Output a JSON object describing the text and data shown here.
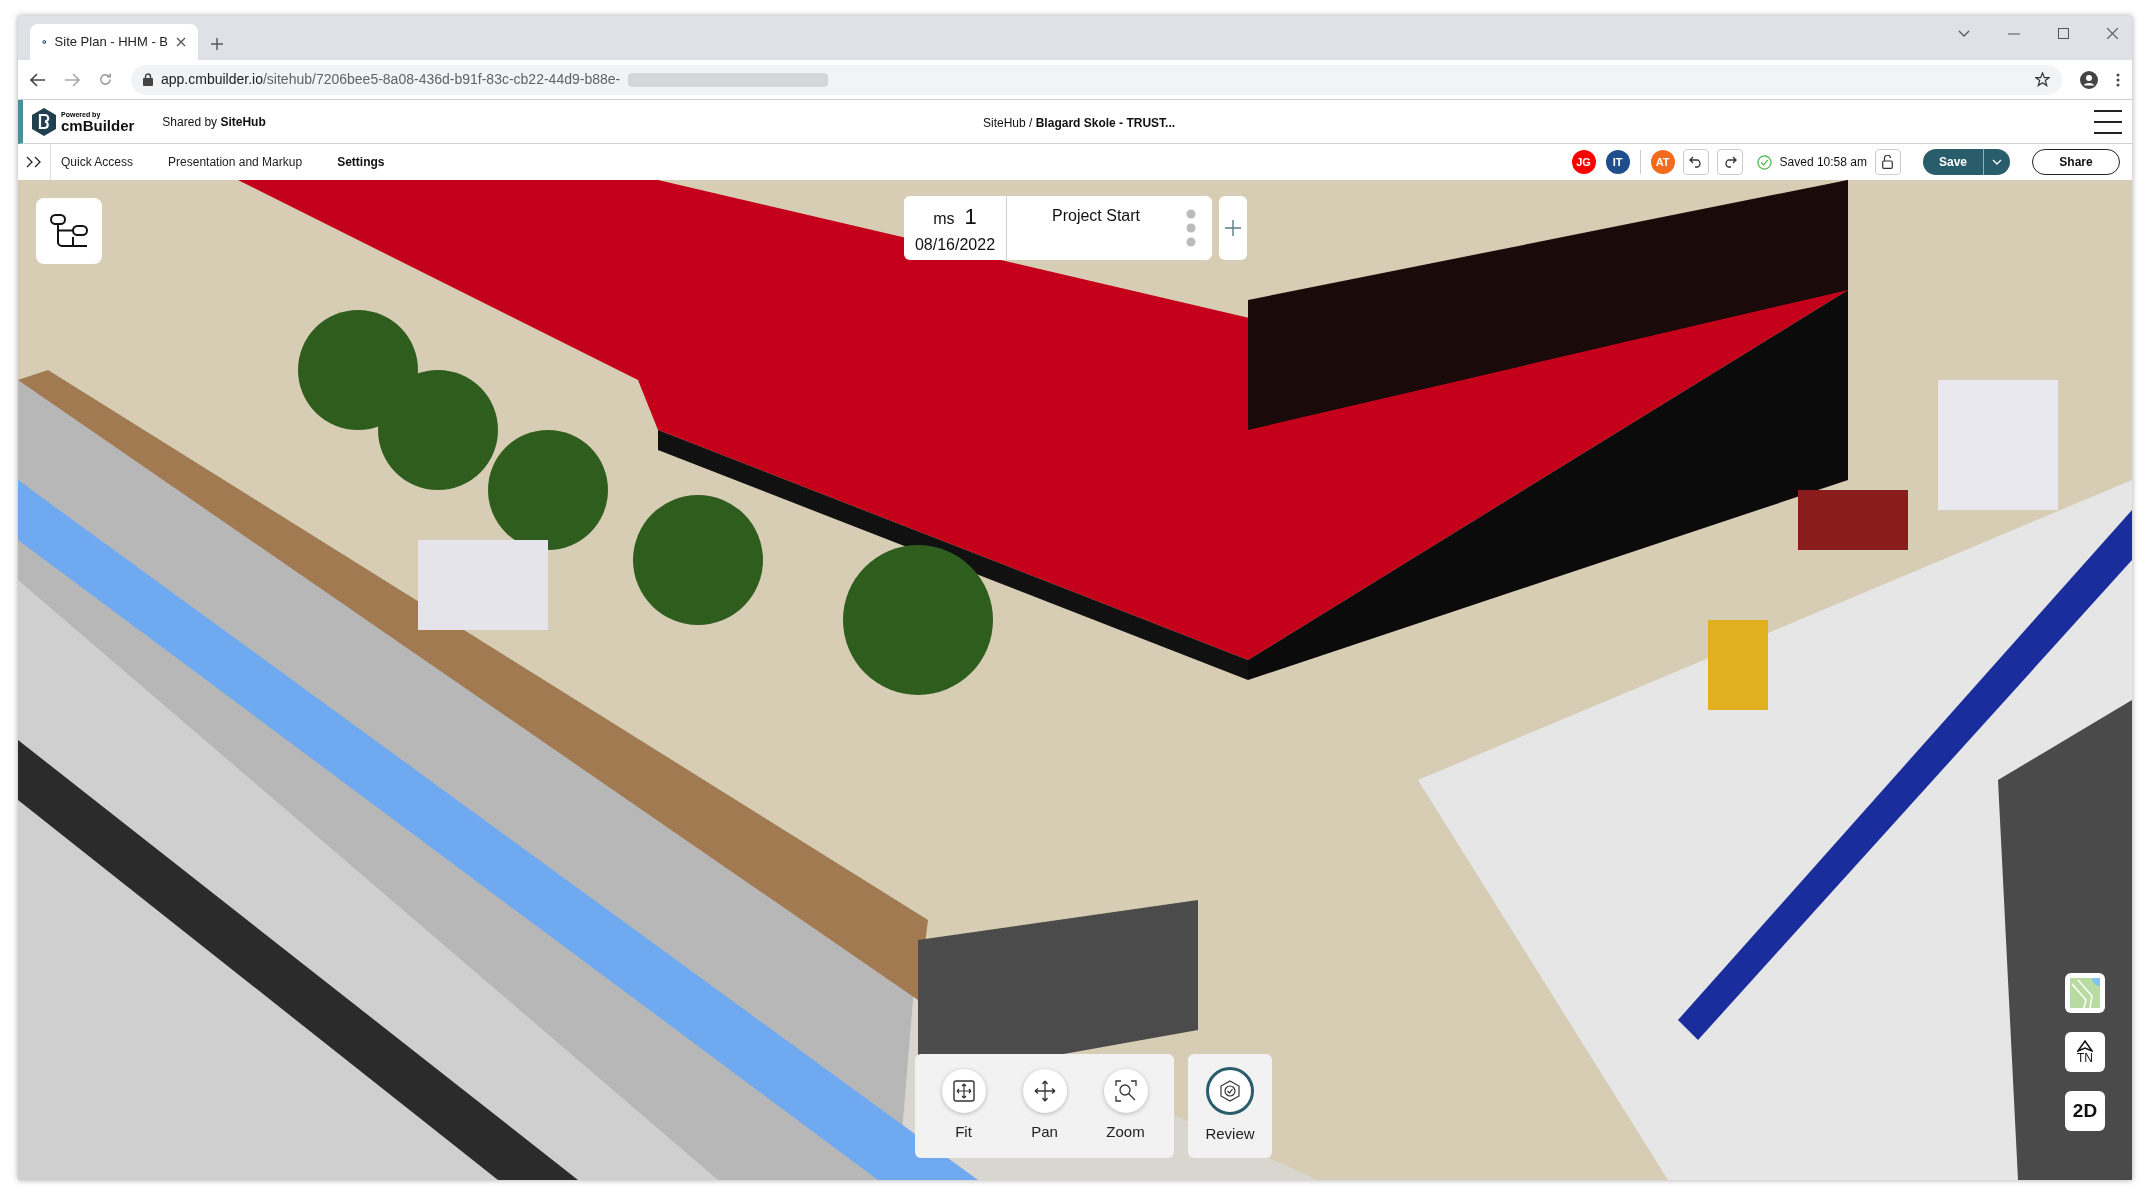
{
  "browser": {
    "tab": {
      "title": "Site Plan - HHM - B"
    },
    "url": {
      "host": "app.cmbuilder.io",
      "path": "/sitehub/7206bee5-8a08-436d-b91f-83c-cb22-44d9-b88e-"
    }
  },
  "app_header": {
    "logo": {
      "powered_by": "Powered by",
      "brand": "cmBuilder"
    },
    "shared_by": "Shared by **SiteHub**",
    "breadcrumb": "SiteHub / **Blagard Skole - TRUST...**"
  },
  "toolbar": {
    "menu": [
      {
        "label": "Quick Access",
        "selected": false
      },
      {
        "label": "Presentation and Markup",
        "selected": false
      },
      {
        "label": "Settings",
        "selected": true
      }
    ],
    "avatars": [
      {
        "initials": "JG",
        "color": "#ff0000"
      },
      {
        "initials": "IT",
        "color": "#1f4e8c"
      },
      {
        "initials": "AT",
        "color": "#f26a1b"
      }
    ],
    "saved": "Saved 10:58 am",
    "save": "Save",
    "share": "Share"
  },
  "milestone": {
    "label": "ms",
    "number": "1",
    "date": "08/16/2022",
    "title": "Project Start"
  },
  "view_tools": [
    {
      "kind": "fit",
      "label": "Fit"
    },
    {
      "kind": "pan",
      "label": "Pan"
    },
    {
      "kind": "zoom",
      "label": "Zoom"
    }
  ],
  "review": {
    "label": "Review"
  },
  "map_controls": {
    "compass": "TN",
    "view_mode": "2D"
  }
}
